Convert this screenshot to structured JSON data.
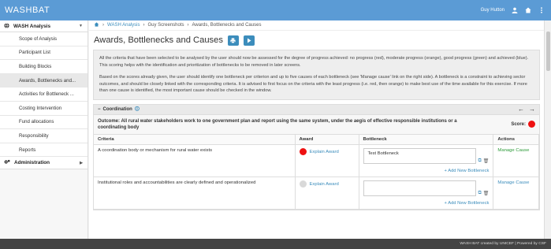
{
  "app": {
    "brand": "WASHBAT",
    "user": "Guy Hutton"
  },
  "sidebar": {
    "section": "WASH Analysis",
    "items": [
      {
        "label": "Scope of Analysis"
      },
      {
        "label": "Participant List"
      },
      {
        "label": "Building Blocks"
      },
      {
        "label": "Awards, Bottlenecks and..."
      },
      {
        "label": "Activities for Bottleneck ..."
      },
      {
        "label": "Costing Intervention"
      },
      {
        "label": "Fund allocations"
      },
      {
        "label": "Responsibility"
      },
      {
        "label": "Reports"
      }
    ],
    "admin": "Administration"
  },
  "breadcrumb": {
    "items": [
      "WASH Analysis",
      "Guy Screenshots",
      "Awards, Bottlenecks and Causes"
    ]
  },
  "page": {
    "title": "Awards, Bottlenecks and Causes"
  },
  "info": {
    "p1": "All the criteria that have been selected to be analysed by the user should now be assessed for the degree of progress achieved: no progress (red), moderate progress (orange), good progress (green) and achieved (blue). This scoring helps with the identification and prioritization of bottlenecks to be removed in later screens.",
    "p2": "Based on the scores already given, the user should identify one bottleneck per criterion and up to five causes of each bottleneck (see 'Manage cause' link on the right side). A bottleneck is a constraint to achieving sector outcomes, and should be closely linked with the corresponding criteria. It is advised to first focus on the criteria with the least progress (i.e. red, then orange) to make best use of the time available for this exercise. If more than one cause is identified, the most important cause should be checked in the window."
  },
  "panel": {
    "title": "Coordination",
    "outcome": "Outcome: All rural water stakeholders work to one government plan and report using the same system, under the aegis of effective responsible institutions or a coordinating body",
    "score_label": "Score:",
    "score_color": "#ee1111",
    "headers": {
      "criteria": "Criteria",
      "award": "Award",
      "bottleneck": "Bottleneck",
      "actions": "Actions"
    },
    "rows": [
      {
        "criteria": "A coordination body or mechanism for rural water exists",
        "award_color": "#ee1111",
        "award_link": "Explain Award",
        "bottleneck": "Test Bottleneck",
        "action": "Manage Cause",
        "add_new": "Add New Bottleneck"
      },
      {
        "criteria": "Institutional roles and accountabilities are clearly defined and operationalized",
        "award_color": "#d9d9d9",
        "award_link": "Explain Award",
        "bottleneck": "",
        "action": "Manage Cause",
        "add_new": "Add New Bottleneck"
      }
    ]
  },
  "footer": {
    "text": "WASH BAT created by UNICEF | Powered by CSF"
  }
}
